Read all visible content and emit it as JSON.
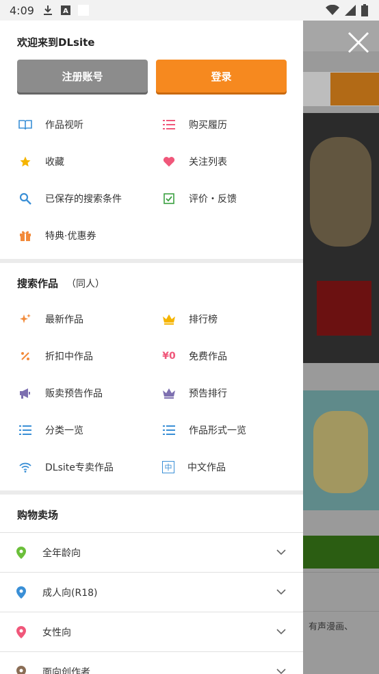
{
  "status_bar": {
    "time": "4:09"
  },
  "drawer": {
    "welcome": "欢迎来到DLsite",
    "register_label": "注册账号",
    "login_label": "登录",
    "account_items": [
      {
        "label": "作品视听",
        "icon": "book-icon"
      },
      {
        "label": "购买履历",
        "icon": "list-icon"
      },
      {
        "label": "收藏",
        "icon": "star-icon"
      },
      {
        "label": "关注列表",
        "icon": "heart-icon"
      },
      {
        "label": "已保存的搜索条件",
        "icon": "search-icon"
      },
      {
        "label": "评价・反馈",
        "icon": "checkbox-icon"
      },
      {
        "label": "特典·优惠券",
        "icon": "gift-icon"
      }
    ],
    "search_section": {
      "title": "搜索作品",
      "subtitle": "（同人）",
      "items": [
        {
          "label": "最新作品",
          "icon": "sparkle-icon"
        },
        {
          "label": "排行榜",
          "icon": "crown-icon"
        },
        {
          "label": "折扣中作品",
          "icon": "percent-icon"
        },
        {
          "label": "免费作品",
          "icon": "yen-zero-icon",
          "icon_text": "¥0"
        },
        {
          "label": "贩卖预告作品",
          "icon": "megaphone-icon"
        },
        {
          "label": "预告排行",
          "icon": "crown-icon"
        },
        {
          "label": "分类一览",
          "icon": "list-icon"
        },
        {
          "label": "作品形式一览",
          "icon": "list-icon"
        },
        {
          "label": "DLsite专卖作品",
          "icon": "wifi-icon"
        },
        {
          "label": "中文作品",
          "icon": "chinese-icon",
          "icon_text": "中"
        }
      ]
    },
    "shop_section": {
      "title": "购物卖场",
      "rows": [
        {
          "label": "全年龄向",
          "pin_color": "#6bbf3a"
        },
        {
          "label": "成人向(R18)",
          "pin_color": "#3a8fd6"
        },
        {
          "label": "女性向",
          "pin_color": "#f0577a"
        },
        {
          "label": "面向创作者",
          "pin_color": "#8a6d55"
        }
      ]
    }
  },
  "background": {
    "tag_text": "有声漫画、"
  },
  "colors": {
    "accent_orange": "#f6891f",
    "register_gray": "#8c8c8c"
  }
}
